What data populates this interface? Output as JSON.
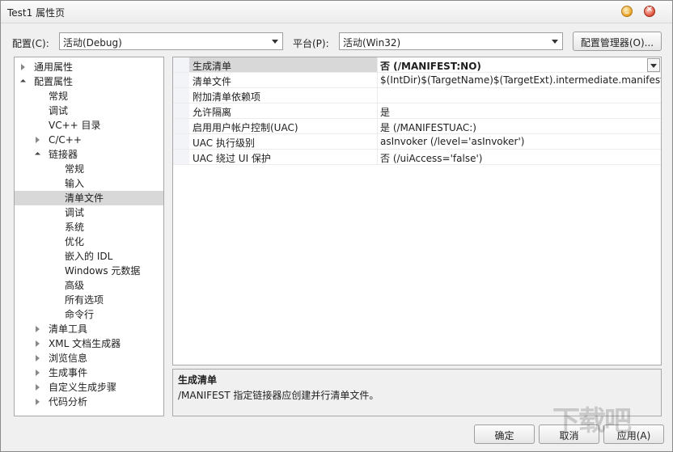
{
  "window": {
    "title": "Test1 属性页"
  },
  "titlebar": {
    "minimize_glyph": "_",
    "close_glyph": "×"
  },
  "toolbar": {
    "config_label": "配置(C):",
    "config_value": "活动(Debug)",
    "platform_label": "平台(P):",
    "platform_value": "活动(Win32)",
    "config_manager_label": "配置管理器(O)..."
  },
  "tree": {
    "nodes": [
      {
        "label": "通用属性",
        "level": 0,
        "state": "collapsed"
      },
      {
        "label": "配置属性",
        "level": 0,
        "state": "expanded"
      },
      {
        "label": "常规",
        "level": 1,
        "state": "leaf"
      },
      {
        "label": "调试",
        "level": 1,
        "state": "leaf"
      },
      {
        "label": "VC++ 目录",
        "level": 1,
        "state": "leaf"
      },
      {
        "label": "C/C++",
        "level": 1,
        "state": "collapsed"
      },
      {
        "label": "链接器",
        "level": 1,
        "state": "expanded"
      },
      {
        "label": "常规",
        "level": 2,
        "state": "leaf"
      },
      {
        "label": "输入",
        "level": 2,
        "state": "leaf"
      },
      {
        "label": "清单文件",
        "level": 2,
        "state": "leaf",
        "selected": true
      },
      {
        "label": "调试",
        "level": 2,
        "state": "leaf"
      },
      {
        "label": "系统",
        "level": 2,
        "state": "leaf"
      },
      {
        "label": "优化",
        "level": 2,
        "state": "leaf"
      },
      {
        "label": "嵌入的 IDL",
        "level": 2,
        "state": "leaf"
      },
      {
        "label": "Windows 元数据",
        "level": 2,
        "state": "leaf"
      },
      {
        "label": "高级",
        "level": 2,
        "state": "leaf"
      },
      {
        "label": "所有选项",
        "level": 2,
        "state": "leaf"
      },
      {
        "label": "命令行",
        "level": 2,
        "state": "leaf"
      },
      {
        "label": "清单工具",
        "level": 1,
        "state": "collapsed"
      },
      {
        "label": "XML 文档生成器",
        "level": 1,
        "state": "collapsed"
      },
      {
        "label": "浏览信息",
        "level": 1,
        "state": "collapsed"
      },
      {
        "label": "生成事件",
        "level": 1,
        "state": "collapsed"
      },
      {
        "label": "自定义生成步骤",
        "level": 1,
        "state": "collapsed"
      },
      {
        "label": "代码分析",
        "level": 1,
        "state": "collapsed"
      }
    ]
  },
  "properties": {
    "rows": [
      {
        "name": "生成清单",
        "value": "否 (/MANIFEST:NO)",
        "selected": true
      },
      {
        "name": "清单文件",
        "value": "$(IntDir)$(TargetName)$(TargetExt).intermediate.manifest"
      },
      {
        "name": "附加清单依赖项",
        "value": ""
      },
      {
        "name": "允许隔离",
        "value": "是"
      },
      {
        "name": "启用用户帐户控制(UAC)",
        "value": "是 (/MANIFESTUAC:)"
      },
      {
        "name": "UAC 执行级别",
        "value": "asInvoker (/level='asInvoker')"
      },
      {
        "name": "UAC 绕过 UI 保护",
        "value": "否 (/uiAccess='false')"
      }
    ]
  },
  "description": {
    "title": "生成清单",
    "text": "/MANIFEST 指定链接器应创建并行清单文件。"
  },
  "footer": {
    "ok_label": "确定",
    "cancel_label": "取消",
    "apply_label": "应用(A)"
  },
  "watermark": {
    "text": "下载吧"
  }
}
